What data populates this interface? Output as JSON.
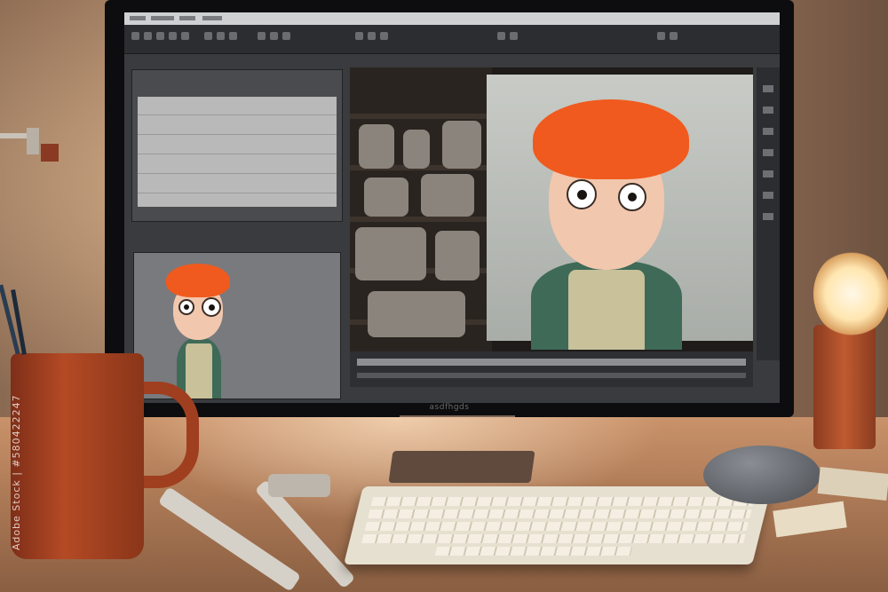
{
  "scene": {
    "description_colors": {
      "hair": "#f05a1e",
      "shirt": "#3f6a58",
      "vest": "#c8c19a",
      "mug": "#b44a25"
    }
  },
  "monitor": {
    "brand_label": "asdfhgds"
  },
  "watermark": {
    "stock_id": "Adobe Stock | #580422247"
  }
}
